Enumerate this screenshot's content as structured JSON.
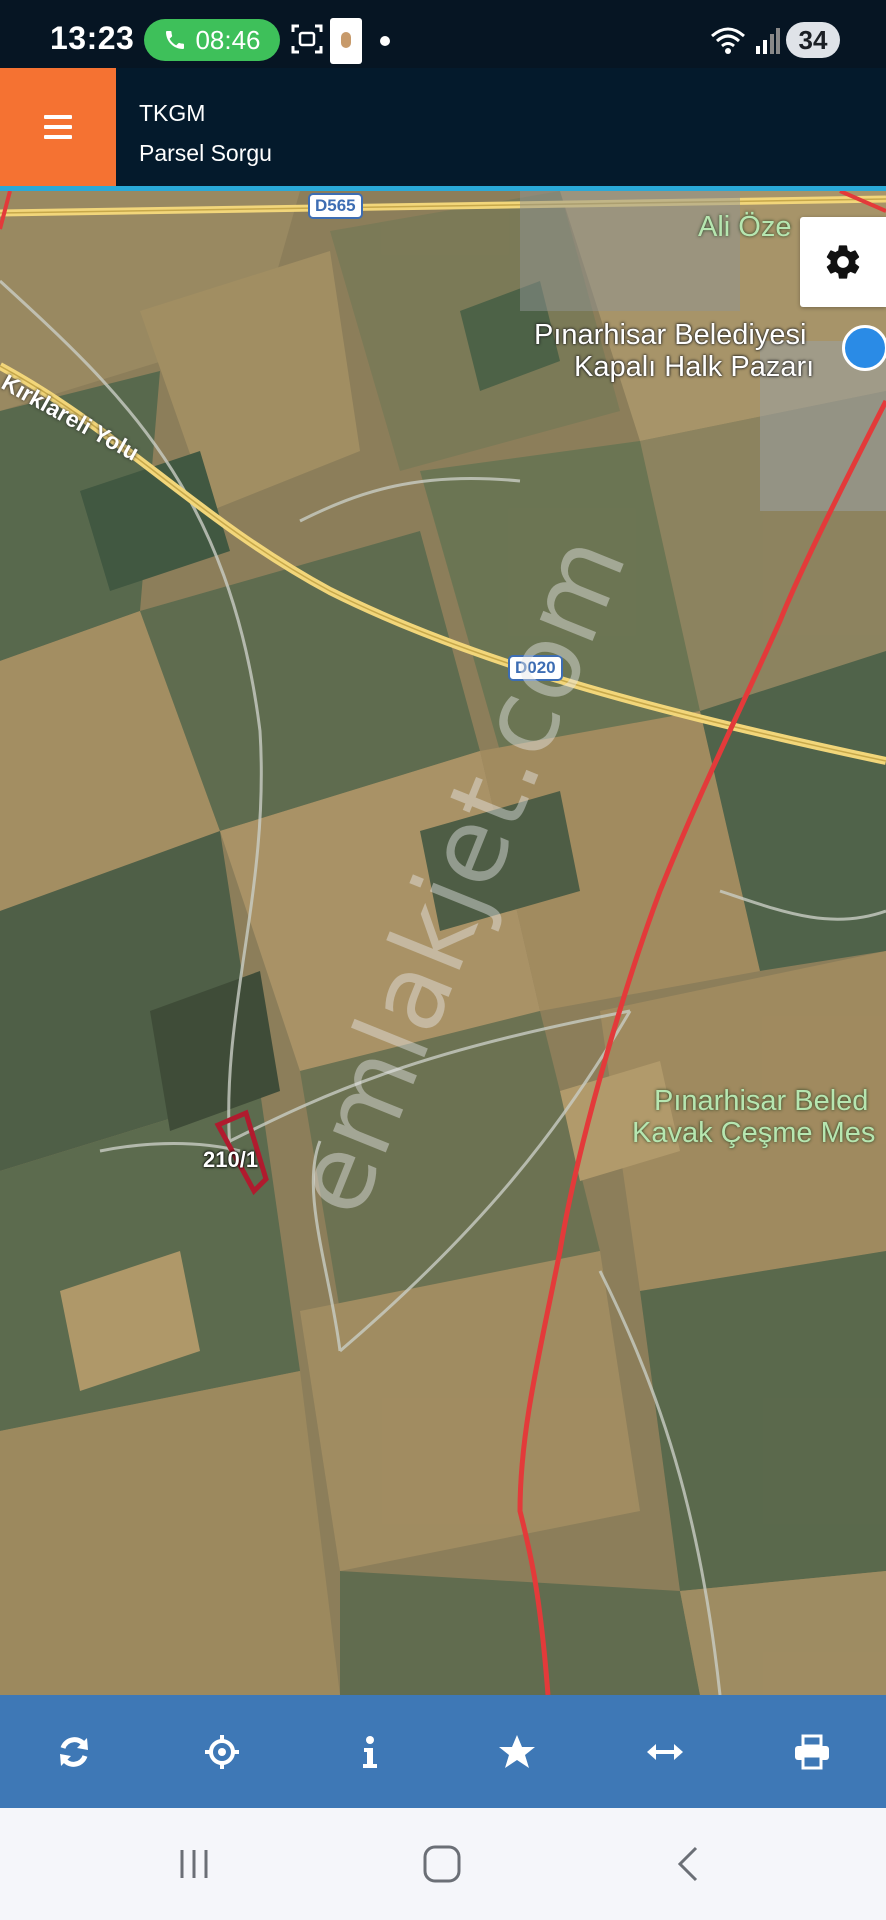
{
  "status_bar": {
    "time": "13:23",
    "call_timer": "08:46",
    "battery": "34",
    "icons": [
      "phone-icon",
      "screen-scan-icon",
      "app-notification-icon",
      "wifi-icon",
      "signal-icon"
    ]
  },
  "header": {
    "title": "TKGM",
    "subtitle": "Parsel Sorgu",
    "menu_icon": "hamburger-menu-icon",
    "accent_color": "#f57232",
    "background_color": "#041a2c"
  },
  "map": {
    "settings_icon": "gear-icon",
    "labels": {
      "road_shield_1": "D565",
      "road_shield_2": "D020",
      "road_name": "Kırklareli Yolu",
      "place_1": "Ali Öze",
      "place_2_line1": "Pınarhisar Belediyesi",
      "place_2_line2": "Kapalı Halk Pazarı",
      "place_3_line1": "Pınarhisar Beled",
      "place_3_line2": "Kavak Çeşme Mes",
      "parcel": "210/1",
      "watermark": "emlakjet.com"
    },
    "boundary_color": "#e33a3a",
    "road_color": "#f2d67a"
  },
  "toolbar": {
    "background_color": "#3e78b6",
    "buttons": [
      "refresh-icon",
      "locate-icon",
      "info-icon",
      "star-icon",
      "measure-icon",
      "print-icon"
    ]
  },
  "nav_bar": {
    "buttons": [
      "recent-apps-icon",
      "home-icon",
      "back-icon"
    ]
  }
}
